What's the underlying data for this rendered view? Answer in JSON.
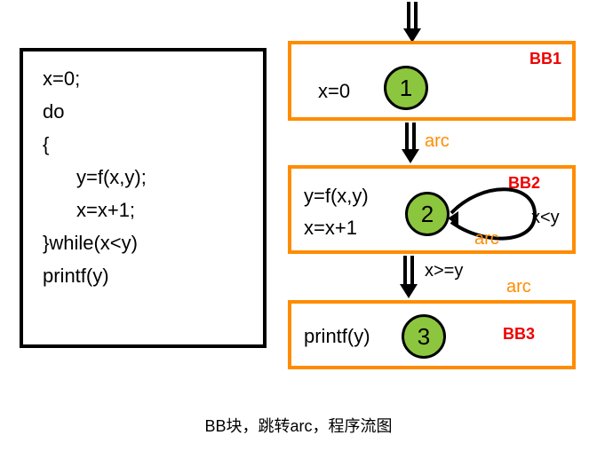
{
  "code": {
    "l1": "x=0;",
    "l2": "do",
    "l3": "{",
    "l4": "y=f(x,y);",
    "l5": "x=x+1;",
    "l6": "}while(x<y)",
    "l7": "printf(y)"
  },
  "bb": {
    "bb1": {
      "label": "BB1",
      "node": "1",
      "stmt": "x=0"
    },
    "bb2": {
      "label": "BB2",
      "node": "2",
      "stmt1": "y=f(x,y)",
      "stmt2": "x=x+1",
      "cond_self": "x<y"
    },
    "bb3": {
      "label": "BB3",
      "node": "3",
      "stmt": "printf(y)"
    }
  },
  "arcs": {
    "a1": "arc",
    "a2": "arc",
    "a3": "arc",
    "cond_exit": "x>=y"
  },
  "caption": "BB块，跳转arc，程序流图"
}
